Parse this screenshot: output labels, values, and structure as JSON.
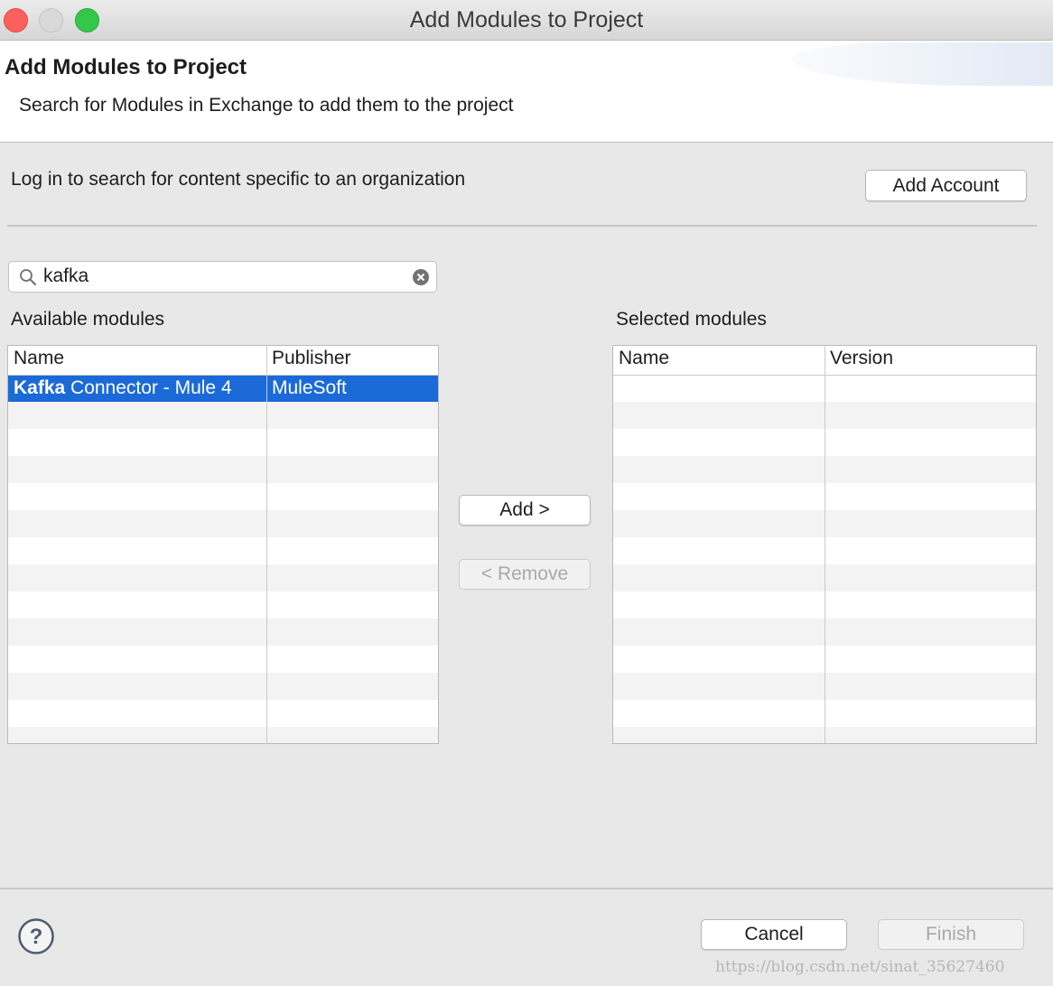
{
  "window": {
    "title": "Add Modules to Project"
  },
  "banner": {
    "title": "Add Modules to Project",
    "subtitle": "Search for Modules in Exchange to add them to the project"
  },
  "account": {
    "prompt": "Log in to search for content specific to an organization",
    "add_account_label": "Add Account"
  },
  "search": {
    "value": "kafka",
    "icon": "search-icon",
    "clear_icon": "clear-icon"
  },
  "available": {
    "label": "Available modules",
    "columns": [
      "Name",
      "Publisher"
    ],
    "rows": [
      {
        "name_bold": "Kafka",
        "name_rest": " Connector - Mule 4",
        "publisher": "MuleSoft",
        "selected": true
      }
    ]
  },
  "selected": {
    "label": "Selected modules",
    "columns": [
      "Name",
      "Version"
    ],
    "rows": []
  },
  "transfer": {
    "add_label": "Add >",
    "remove_label": "< Remove"
  },
  "footer": {
    "cancel_label": "Cancel",
    "finish_label": "Finish",
    "help_icon": "help-icon"
  },
  "watermark": "https://blog.csdn.net/sinat_35627460",
  "colors": {
    "selection": "#1b6ad8",
    "close": "#fc605c",
    "maximize": "#34c84a"
  }
}
